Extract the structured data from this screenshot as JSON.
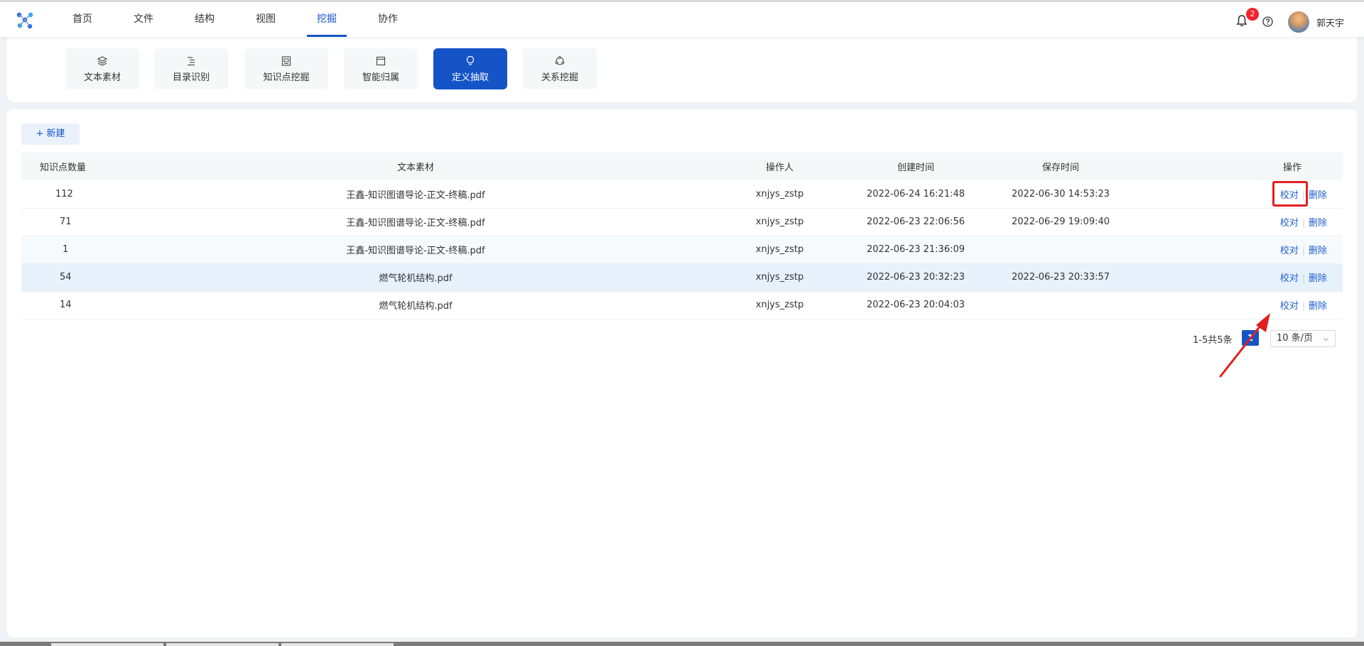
{
  "nav": {
    "items": [
      {
        "label": "首页",
        "active": false
      },
      {
        "label": "文件",
        "active": false
      },
      {
        "label": "结构",
        "active": false
      },
      {
        "label": "视图",
        "active": false
      },
      {
        "label": "挖掘",
        "active": true
      },
      {
        "label": "协作",
        "active": false
      }
    ],
    "notification_count": "2",
    "user_name": "郭天宇",
    "accent_color": "#1554c6"
  },
  "tools": {
    "items": [
      {
        "label": "文本素材",
        "icon": "layers-icon",
        "active": false
      },
      {
        "label": "目录识别",
        "icon": "list-indent-icon",
        "active": false
      },
      {
        "label": "知识点挖掘",
        "icon": "document-frame-icon",
        "active": false
      },
      {
        "label": "智能归属",
        "icon": "window-icon",
        "active": false
      },
      {
        "label": "定义抽取",
        "icon": "lightbulb-icon",
        "active": true
      },
      {
        "label": "关系挖掘",
        "icon": "cycle-nodes-icon",
        "active": false
      }
    ]
  },
  "toolbar": {
    "new_label": "+ 新建"
  },
  "table": {
    "columns": [
      "知识点数量",
      "文本素材",
      "操作人",
      "创建时间",
      "保存时间",
      "操作"
    ],
    "rows": [
      {
        "count": "112",
        "material": "王鑫-知识图谱导论-正文-终稿.pdf",
        "operator": "xnjys_zstp",
        "created": "2022-06-24 16:21:48",
        "saved": "2022-06-30 14:53:23"
      },
      {
        "count": "71",
        "material": "王鑫-知识图谱导论-正文-终稿.pdf",
        "operator": "xnjys_zstp",
        "created": "2022-06-23 22:06:56",
        "saved": "2022-06-29 19:09:40"
      },
      {
        "count": "1",
        "material": "王鑫-知识图谱导论-正文-终稿.pdf",
        "operator": "xnjys_zstp",
        "created": "2022-06-23 21:36:09",
        "saved": ""
      },
      {
        "count": "54",
        "material": "燃气轮机结构.pdf",
        "operator": "xnjys_zstp",
        "created": "2022-06-23 20:32:23",
        "saved": "2022-06-23 20:33:57"
      },
      {
        "count": "14",
        "material": "燃气轮机结构.pdf",
        "operator": "xnjys_zstp",
        "created": "2022-06-23 20:04:03",
        "saved": ""
      }
    ],
    "action_proofread": "校对",
    "action_delete": "删除"
  },
  "pagination": {
    "total_text": "1-5共5条",
    "current_page": "1",
    "page_size": "10 条/页"
  }
}
